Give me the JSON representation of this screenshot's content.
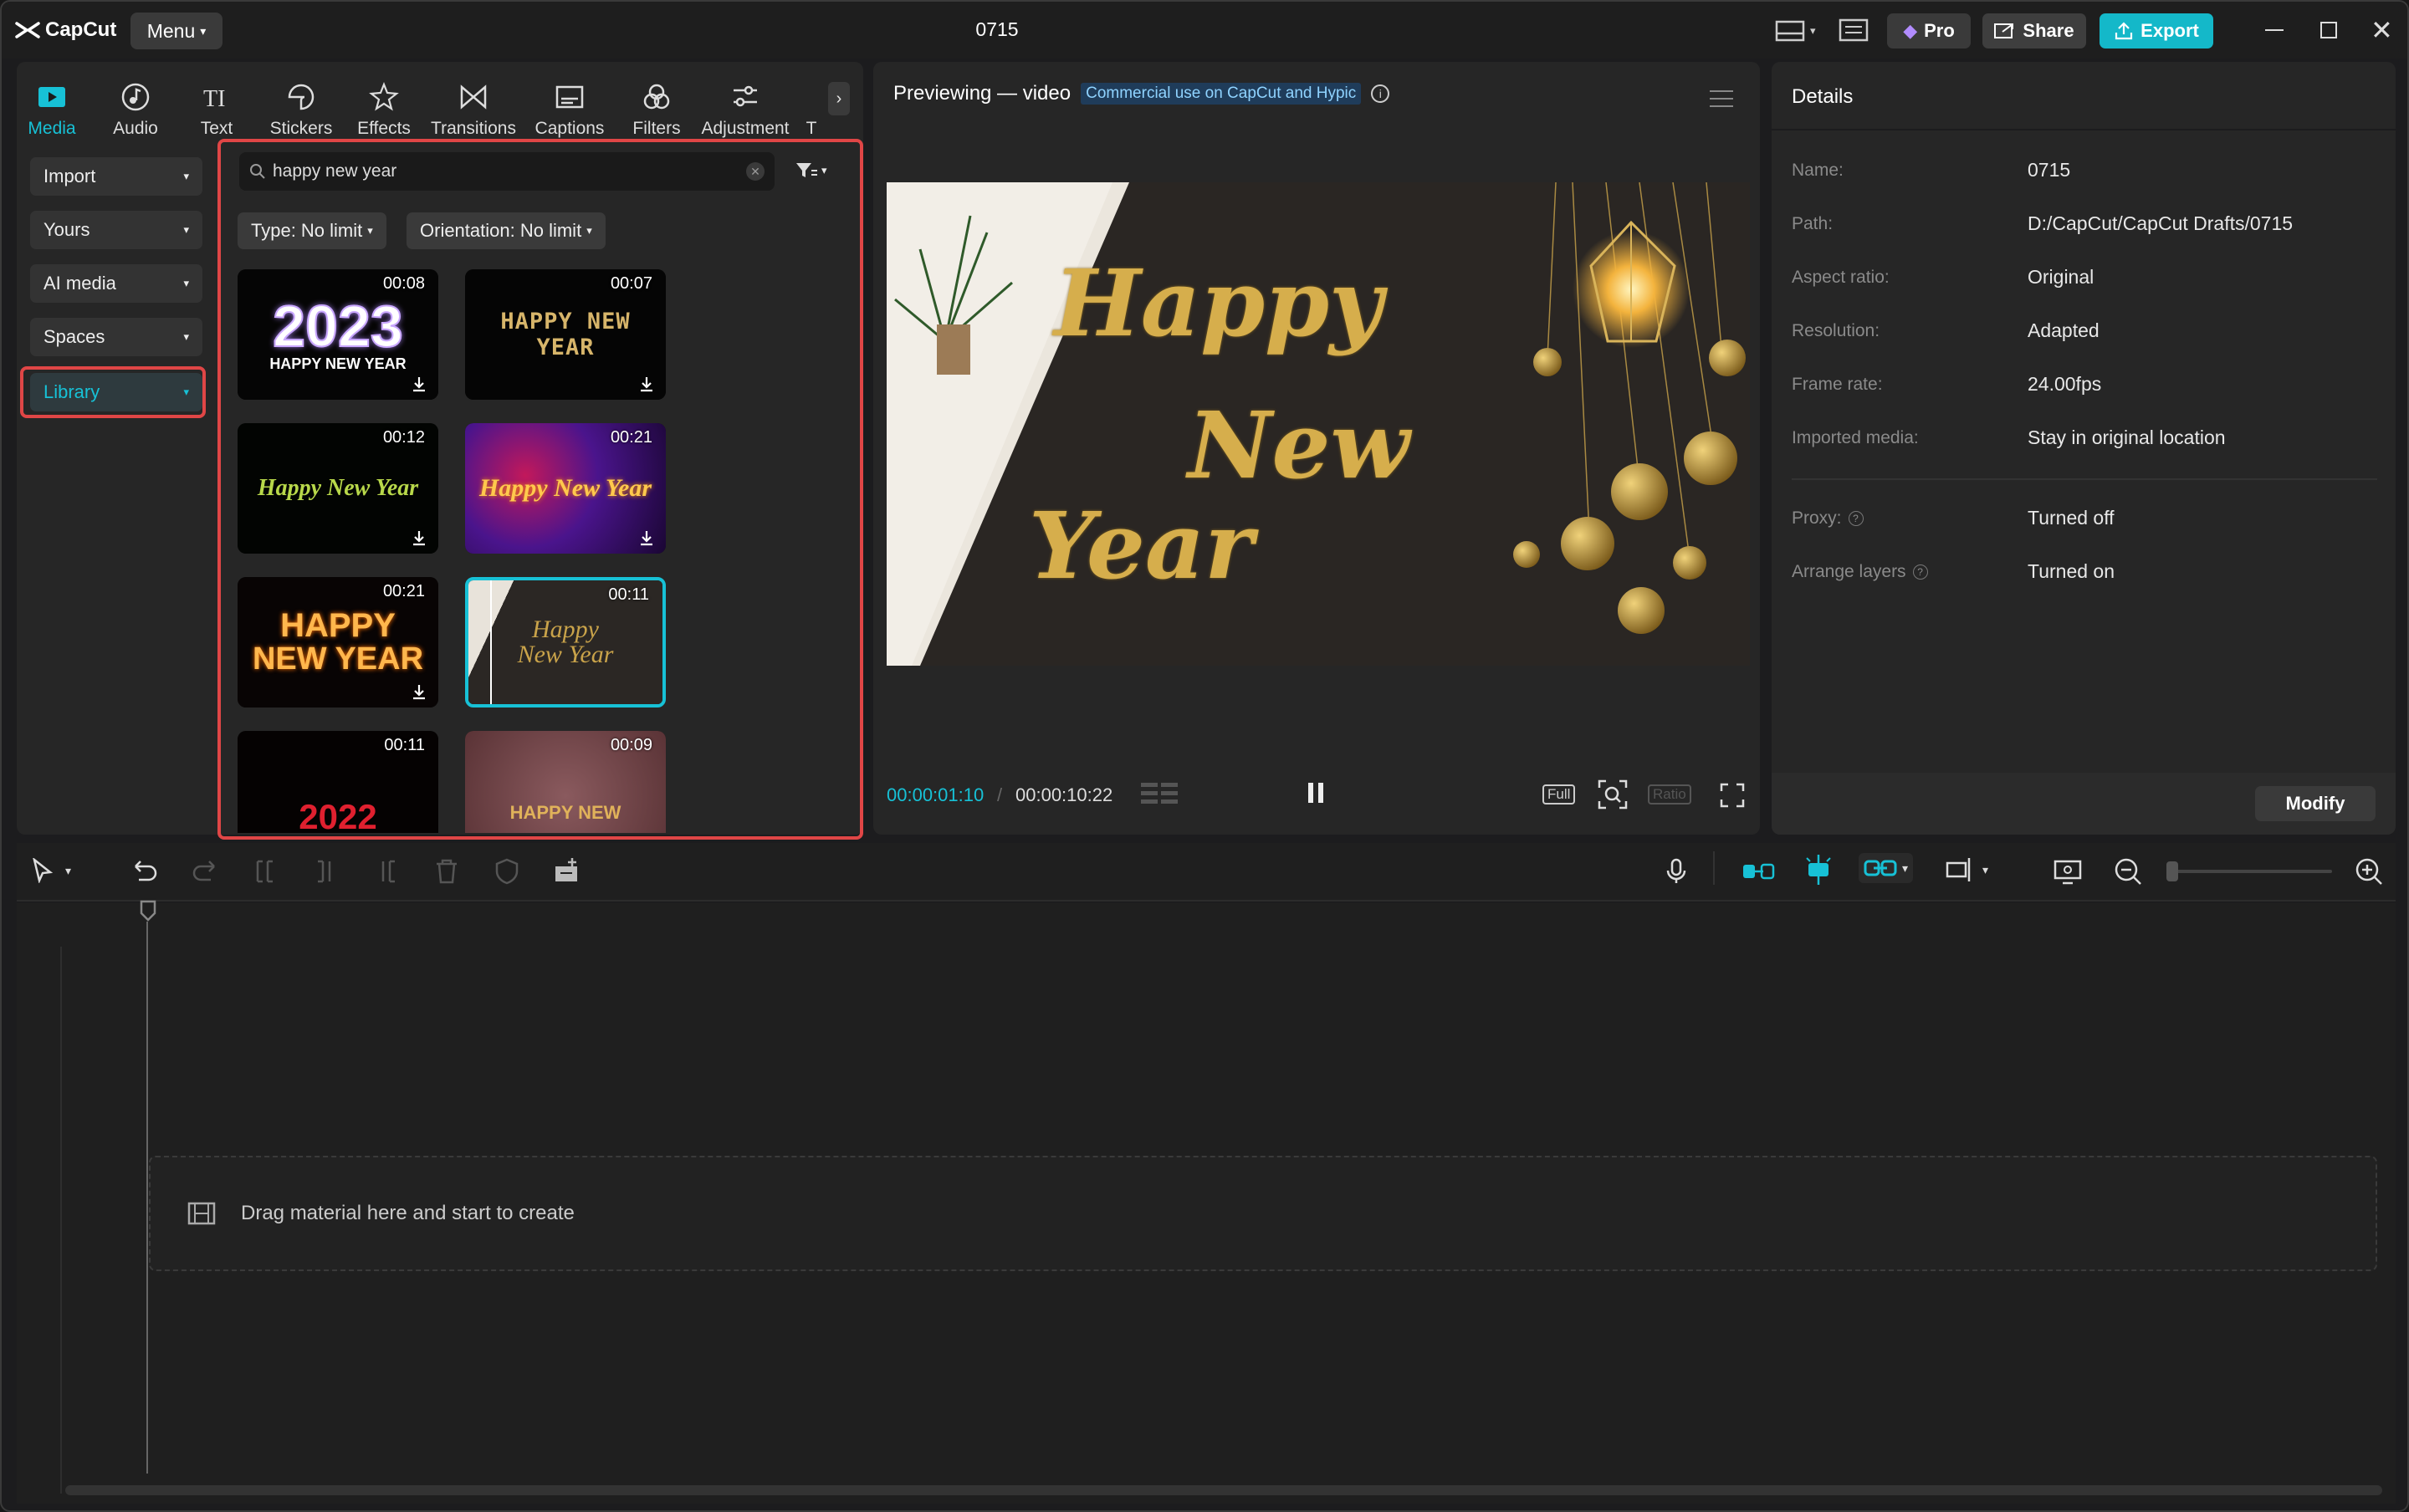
{
  "app": {
    "name": "CapCut",
    "menu_label": "Menu",
    "window_title": "0715"
  },
  "topbar": {
    "pro_label": "Pro",
    "share_label": "Share",
    "export_label": "Export",
    "colors": {
      "accent": "#17c1d6",
      "export_bg": "#14b8c9"
    }
  },
  "media_tabs": [
    {
      "label": "Media",
      "icon": "media-icon",
      "active": true
    },
    {
      "label": "Audio",
      "icon": "audio-icon"
    },
    {
      "label": "Text",
      "icon": "text-icon"
    },
    {
      "label": "Stickers",
      "icon": "sticker-icon"
    },
    {
      "label": "Effects",
      "icon": "effects-icon"
    },
    {
      "label": "Transitions",
      "icon": "transitions-icon"
    },
    {
      "label": "Captions",
      "icon": "captions-icon"
    },
    {
      "label": "Filters",
      "icon": "filters-icon"
    },
    {
      "label": "Adjustment",
      "icon": "adjustment-icon"
    },
    {
      "label": "T"
    }
  ],
  "sidebar": [
    {
      "label": "Import"
    },
    {
      "label": "Yours"
    },
    {
      "label": "AI media"
    },
    {
      "label": "Spaces"
    },
    {
      "label": "Library",
      "active": true
    }
  ],
  "search": {
    "value": "happy new year"
  },
  "filters": {
    "type_label": "Type: No limit",
    "orientation_label": "Orientation: No limit"
  },
  "library_items": [
    {
      "duration": "00:08",
      "art": "2023",
      "caption": "HAPPY NEW YEAR"
    },
    {
      "duration": "00:07",
      "art": "HAPPY NEW YEAR"
    },
    {
      "duration": "00:12",
      "art": "Happy New Year"
    },
    {
      "duration": "00:21",
      "art": "Happy New Year"
    },
    {
      "duration": "00:21",
      "art": "HAPPY",
      "caption": "NEW YEAR"
    },
    {
      "duration": "00:11",
      "art": "Happy New Year",
      "selected": true
    },
    {
      "duration": "00:11",
      "art": "2022"
    },
    {
      "duration": "00:09",
      "art": "HAPPY NEW"
    }
  ],
  "preview": {
    "title": "Previewing — video",
    "badge": "Commercial use on CapCut and Hypic",
    "video_text": [
      "Happy",
      "New",
      "Year"
    ],
    "time_current": "00:00:01:10",
    "time_total": "00:00:10:22",
    "full_label": "Full",
    "ratio_label": "Ratio"
  },
  "details": {
    "title": "Details",
    "rows": [
      {
        "label": "Name:",
        "value": "0715"
      },
      {
        "label": "Path:",
        "value": "D:/CapCut/CapCut Drafts/0715"
      },
      {
        "label": "Aspect ratio:",
        "value": "Original"
      },
      {
        "label": "Resolution:",
        "value": "Adapted"
      },
      {
        "label": "Frame rate:",
        "value": "24.00fps"
      },
      {
        "label": "Imported media:",
        "value": "Stay in original location"
      },
      {
        "label": "Proxy:",
        "value": "Turned off"
      },
      {
        "label": "Arrange layers",
        "value": "Turned on"
      }
    ],
    "modify_label": "Modify"
  },
  "timeline": {
    "drop_hint": "Drag material here and start to create"
  }
}
